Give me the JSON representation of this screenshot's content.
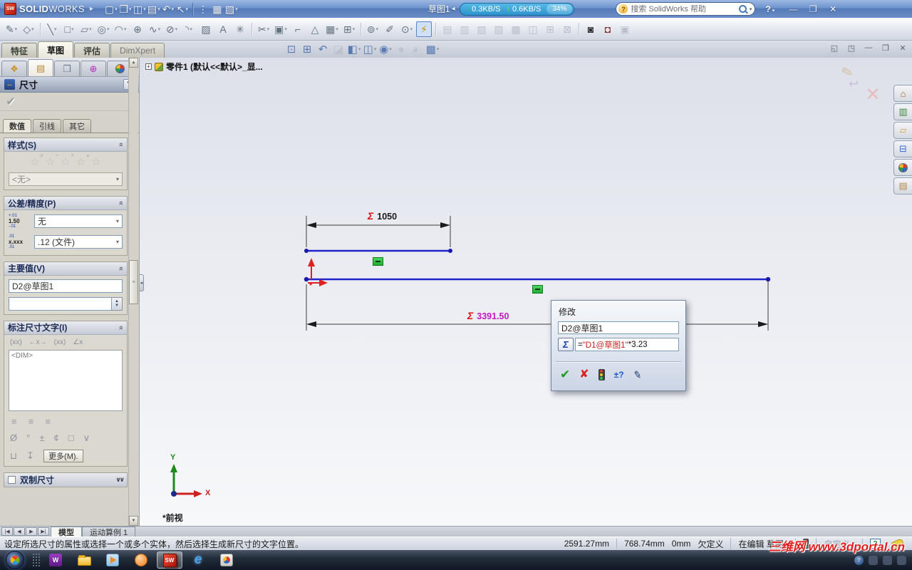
{
  "titlebar": {
    "logo_bold": "SOLID",
    "logo_light": "WORKS",
    "doc_label": "草图1",
    "net_down": "0.3KB/S",
    "net_up": "0.6KB/S",
    "net_pct": "34%",
    "search_placeholder": "搜索 SolidWorks 帮助"
  },
  "toolbars": {
    "standard": [
      {
        "name": "new-document-icon",
        "glyph": "▢",
        "dd": true
      },
      {
        "name": "open-document-icon",
        "glyph": "❒",
        "dd": true
      },
      {
        "name": "save-icon",
        "glyph": "◫",
        "dd": true
      },
      {
        "name": "print-icon",
        "glyph": "▤",
        "dd": true
      },
      {
        "name": "undo-icon",
        "glyph": "↶",
        "dd": true
      },
      {
        "name": "select-icon",
        "glyph": "↖",
        "dd": true
      },
      {
        "sep": true
      },
      {
        "name": "toggle-display-icon",
        "glyph": "⋮"
      },
      {
        "name": "file-properties-icon",
        "glyph": "▦"
      },
      {
        "name": "options-icon",
        "glyph": "▧",
        "dd": true
      }
    ],
    "sketch": [
      {
        "name": "exit-sketch-icon",
        "glyph": "✎",
        "dd": true
      },
      {
        "name": "smart-dimension-icon",
        "glyph": "◇",
        "dd": true
      },
      {
        "sep": true
      },
      {
        "name": "line-tool-icon",
        "glyph": "╲",
        "dd": true
      },
      {
        "name": "rectangle-tool-icon",
        "glyph": "□",
        "dd": true
      },
      {
        "name": "slot-tool-icon",
        "glyph": "▱",
        "dd": true
      },
      {
        "name": "circle-tool-icon",
        "glyph": "◎",
        "dd": true
      },
      {
        "name": "arc-tool-icon",
        "glyph": "◠",
        "dd": true
      },
      {
        "name": "polygon-tool-icon",
        "glyph": "⊕"
      },
      {
        "name": "spline-tool-icon",
        "glyph": "∿",
        "dd": true
      },
      {
        "name": "ellipse-tool-icon",
        "glyph": "⊘",
        "dd": true
      },
      {
        "name": "fillet-tool-icon",
        "glyph": "◝",
        "dd": true
      },
      {
        "name": "plane-tool-icon",
        "glyph": "▨"
      },
      {
        "name": "text-tool-icon",
        "glyph": "A"
      },
      {
        "name": "point-tool-icon",
        "glyph": "✳"
      },
      {
        "sep": true
      },
      {
        "name": "trim-entities-icon",
        "glyph": "✂",
        "dd": true
      },
      {
        "name": "convert-entities-icon",
        "glyph": "▣",
        "dd": true
      },
      {
        "name": "offset-entities-icon",
        "glyph": "⌐"
      },
      {
        "name": "mirror-entities-icon",
        "glyph": "△"
      },
      {
        "name": "linear-pattern-icon",
        "glyph": "▦",
        "dd": true
      },
      {
        "name": "move-entities-icon",
        "glyph": "⊞",
        "dd": true
      },
      {
        "sep": true
      },
      {
        "name": "display-relations-icon",
        "glyph": "⊚",
        "dd": true
      },
      {
        "name": "repair-sketch-icon",
        "glyph": "✐"
      },
      {
        "name": "quick-snaps-icon",
        "glyph": "⊙",
        "dd": true
      },
      {
        "name": "rapid-sketch-icon",
        "glyph": "⚡",
        "cls": "hl",
        "color": "#c79100"
      },
      {
        "sep": true
      },
      {
        "name": "make-block-icon",
        "glyph": "▤",
        "cls": "dis"
      },
      {
        "name": "edit-block-icon",
        "glyph": "▥",
        "cls": "dis"
      },
      {
        "name": "insert-block-icon",
        "glyph": "▧",
        "cls": "dis"
      },
      {
        "name": "add-remove-block-icon",
        "glyph": "▨",
        "cls": "dis"
      },
      {
        "name": "rebuild-block-icon",
        "glyph": "▩",
        "cls": "dis"
      },
      {
        "name": "save-block-icon",
        "glyph": "◫",
        "cls": "dis"
      },
      {
        "name": "explode-block-icon",
        "glyph": "⊞",
        "cls": "dis"
      },
      {
        "name": "belt-chain-icon",
        "glyph": "⊠",
        "cls": "dis"
      },
      {
        "sep": true
      },
      {
        "name": "screen-capture-icon",
        "glyph": "◙",
        "color": "#2b2b2b"
      },
      {
        "name": "record-video-icon",
        "glyph": "◘",
        "color": "#8a2b2b"
      },
      {
        "name": "stop-video-icon",
        "glyph": "▣",
        "cls": "dis"
      }
    ],
    "headsup": [
      {
        "name": "zoom-fit-icon",
        "glyph": "⊡"
      },
      {
        "name": "zoom-area-icon",
        "glyph": "⊞"
      },
      {
        "name": "previous-view-icon",
        "glyph": "↶"
      },
      {
        "name": "section-view-icon",
        "glyph": "◪",
        "cls": "dis"
      },
      {
        "name": "view-orientation-icon",
        "glyph": "◧",
        "dd": true
      },
      {
        "name": "display-style-icon",
        "glyph": "◫",
        "dd": true
      },
      {
        "name": "hide-show-items-icon",
        "glyph": "◉",
        "dd": true
      },
      {
        "name": "shadows-icon",
        "glyph": "●",
        "cls": "dis"
      },
      {
        "name": "appearances-icon",
        "glyph": "◕",
        "cls": "dis",
        "dd": true
      },
      {
        "name": "scene-icon",
        "glyph": "▩",
        "dd": true
      }
    ]
  },
  "command_tabs": [
    {
      "label": "特征"
    },
    {
      "label": "草图"
    },
    {
      "label": "评估"
    },
    {
      "label": "DimXpert"
    }
  ],
  "doc_window_controls": [
    "◱",
    "◳",
    "—",
    "❐",
    "✕"
  ],
  "feature_tree": {
    "item": "零件1 (默认<<默认>_显..."
  },
  "property_manager": {
    "title": "尺寸",
    "help": "?",
    "ok_icon": "✔",
    "tabs": [
      {
        "label": "数值"
      },
      {
        "label": "引线"
      },
      {
        "label": "其它"
      }
    ],
    "style_group": {
      "label": "样式(S)",
      "combo": "<无>"
    },
    "tolerance_group": {
      "label": "公差/精度(P)",
      "tol_icon": {
        "top": "+.01",
        "mid": "1.50",
        "bot": "-.01"
      },
      "prec_icon": {
        "top": ".01",
        "mid": "x.xxx",
        "bot": ".01"
      },
      "combo1": "无",
      "combo2": ".12 (文件)"
    },
    "primary_group": {
      "label": "主要值(V)",
      "name_value": "D2@草图1",
      "value": ""
    },
    "dimtext_group": {
      "label": "标注尺寸文字(I)",
      "icons": [
        "(xx)",
        "←x→",
        "(xx)",
        "∠x"
      ],
      "placeholder": "<DIM>",
      "more_label": "更多(M)."
    },
    "dual_group": {
      "label": "双制尺寸"
    }
  },
  "sketch": {
    "sigma": "Σ",
    "dim1_value": "1050",
    "dim2_value": "3391.50",
    "view_label": "*前视",
    "triad_x": "X",
    "triad_y": "Y"
  },
  "modify_dialog": {
    "title": "修改",
    "name_field": "D2@草图1",
    "sigma": "Σ",
    "equation": {
      "prefix": "=",
      "reference": "\"D1@草图1\"",
      "suffix": "*3.23"
    },
    "tol_button": "±?"
  },
  "doc_tabs": [
    {
      "label": "模型"
    },
    {
      "label": "运动算例 1"
    }
  ],
  "statusbar": {
    "message": "设定所选尺寸的属性或选择一个或多个实体，然后选择生成新尺寸的文字位置。",
    "x": "2591.27mm",
    "y": "768.74mm",
    "z": "0mm",
    "state": "欠定义",
    "editing": "在编辑 草图1",
    "custom": "自定义"
  },
  "taskbar": {
    "watermark": "三维网 www.3dportal.cn"
  },
  "colors": {
    "sketch_line": "#2222cc",
    "dimension_line": "#3c3c3c",
    "sigma_red": "#e01010",
    "selected_dim": "#c21ac2",
    "constraint_green": "#2fc040",
    "origin_red": "#dd2222"
  }
}
